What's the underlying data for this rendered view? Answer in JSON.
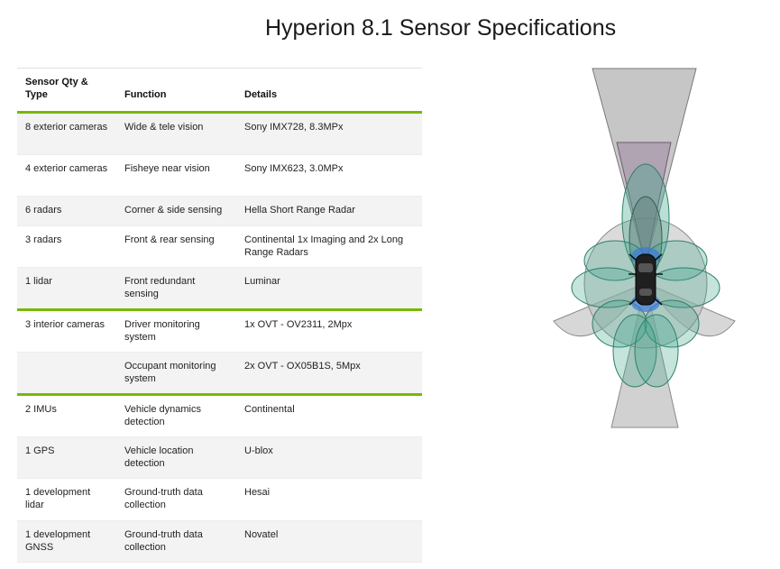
{
  "title": "Hyperion 8.1 Sensor Specifications",
  "columns": [
    "Sensor Qty & Type",
    "Function",
    "Details"
  ],
  "rows": [
    {
      "type": "8 exterior cameras",
      "function": "Wide & tele vision",
      "details": "Sony IMX728, 8.3MPx"
    },
    {
      "type": "4 exterior cameras",
      "function": "Fisheye near vision",
      "details": "Sony IMX623, 3.0MPx"
    },
    {
      "type": "6 radars",
      "function": "Corner & side sensing",
      "details": "Hella Short Range Radar"
    },
    {
      "type": "3 radars",
      "function": "Front & rear sensing",
      "details": "Continental 1x Imaging and 2x Long Range Radars"
    },
    {
      "type": "1 lidar",
      "function": "Front redundant sensing",
      "details": "Luminar"
    },
    {
      "type": "3 interior cameras",
      "function": "Driver monitoring system",
      "details": "1x OVT - OV2311, 2Mpx"
    },
    {
      "type": "",
      "function": "Occupant monitoring system",
      "details": "2x OVT - OX05B1S, 5Mpx"
    },
    {
      "type": "2 IMUs",
      "function": "Vehicle dynamics detection",
      "details": "Continental"
    },
    {
      "type": "1 GPS",
      "function": "Vehicle location detection",
      "details": "U-blox"
    },
    {
      "type": "1 development lidar",
      "function": "Ground-truth data collection",
      "details": "Hesai"
    },
    {
      "type": "1 development GNSS",
      "function": "Ground-truth data collection",
      "details": "Novatel"
    }
  ],
  "colors": {
    "accent": "#76b900",
    "row_alt": "#f3f3f3",
    "radar": "#9a9a9a",
    "camera": "#3aa58a",
    "lidar": "#8a6f8f",
    "car_sensor": "#3a7bd5"
  }
}
